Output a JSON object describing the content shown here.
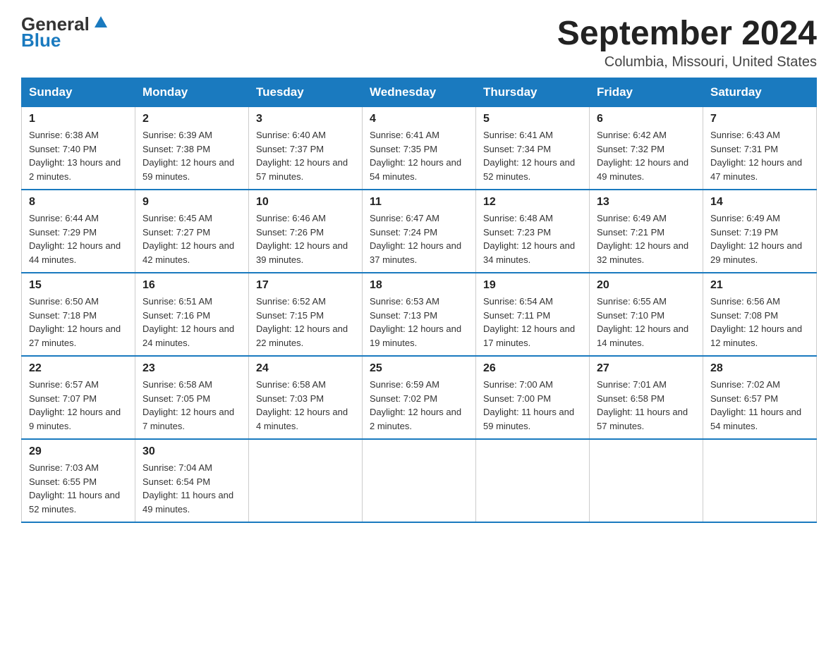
{
  "header": {
    "logo_general": "General",
    "logo_blue": "Blue",
    "title": "September 2024",
    "subtitle": "Columbia, Missouri, United States"
  },
  "days_of_week": [
    "Sunday",
    "Monday",
    "Tuesday",
    "Wednesday",
    "Thursday",
    "Friday",
    "Saturday"
  ],
  "weeks": [
    [
      {
        "day": "1",
        "sunrise": "6:38 AM",
        "sunset": "7:40 PM",
        "daylight": "13 hours and 2 minutes."
      },
      {
        "day": "2",
        "sunrise": "6:39 AM",
        "sunset": "7:38 PM",
        "daylight": "12 hours and 59 minutes."
      },
      {
        "day": "3",
        "sunrise": "6:40 AM",
        "sunset": "7:37 PM",
        "daylight": "12 hours and 57 minutes."
      },
      {
        "day": "4",
        "sunrise": "6:41 AM",
        "sunset": "7:35 PM",
        "daylight": "12 hours and 54 minutes."
      },
      {
        "day": "5",
        "sunrise": "6:41 AM",
        "sunset": "7:34 PM",
        "daylight": "12 hours and 52 minutes."
      },
      {
        "day": "6",
        "sunrise": "6:42 AM",
        "sunset": "7:32 PM",
        "daylight": "12 hours and 49 minutes."
      },
      {
        "day": "7",
        "sunrise": "6:43 AM",
        "sunset": "7:31 PM",
        "daylight": "12 hours and 47 minutes."
      }
    ],
    [
      {
        "day": "8",
        "sunrise": "6:44 AM",
        "sunset": "7:29 PM",
        "daylight": "12 hours and 44 minutes."
      },
      {
        "day": "9",
        "sunrise": "6:45 AM",
        "sunset": "7:27 PM",
        "daylight": "12 hours and 42 minutes."
      },
      {
        "day": "10",
        "sunrise": "6:46 AM",
        "sunset": "7:26 PM",
        "daylight": "12 hours and 39 minutes."
      },
      {
        "day": "11",
        "sunrise": "6:47 AM",
        "sunset": "7:24 PM",
        "daylight": "12 hours and 37 minutes."
      },
      {
        "day": "12",
        "sunrise": "6:48 AM",
        "sunset": "7:23 PM",
        "daylight": "12 hours and 34 minutes."
      },
      {
        "day": "13",
        "sunrise": "6:49 AM",
        "sunset": "7:21 PM",
        "daylight": "12 hours and 32 minutes."
      },
      {
        "day": "14",
        "sunrise": "6:49 AM",
        "sunset": "7:19 PM",
        "daylight": "12 hours and 29 minutes."
      }
    ],
    [
      {
        "day": "15",
        "sunrise": "6:50 AM",
        "sunset": "7:18 PM",
        "daylight": "12 hours and 27 minutes."
      },
      {
        "day": "16",
        "sunrise": "6:51 AM",
        "sunset": "7:16 PM",
        "daylight": "12 hours and 24 minutes."
      },
      {
        "day": "17",
        "sunrise": "6:52 AM",
        "sunset": "7:15 PM",
        "daylight": "12 hours and 22 minutes."
      },
      {
        "day": "18",
        "sunrise": "6:53 AM",
        "sunset": "7:13 PM",
        "daylight": "12 hours and 19 minutes."
      },
      {
        "day": "19",
        "sunrise": "6:54 AM",
        "sunset": "7:11 PM",
        "daylight": "12 hours and 17 minutes."
      },
      {
        "day": "20",
        "sunrise": "6:55 AM",
        "sunset": "7:10 PM",
        "daylight": "12 hours and 14 minutes."
      },
      {
        "day": "21",
        "sunrise": "6:56 AM",
        "sunset": "7:08 PM",
        "daylight": "12 hours and 12 minutes."
      }
    ],
    [
      {
        "day": "22",
        "sunrise": "6:57 AM",
        "sunset": "7:07 PM",
        "daylight": "12 hours and 9 minutes."
      },
      {
        "day": "23",
        "sunrise": "6:58 AM",
        "sunset": "7:05 PM",
        "daylight": "12 hours and 7 minutes."
      },
      {
        "day": "24",
        "sunrise": "6:58 AM",
        "sunset": "7:03 PM",
        "daylight": "12 hours and 4 minutes."
      },
      {
        "day": "25",
        "sunrise": "6:59 AM",
        "sunset": "7:02 PM",
        "daylight": "12 hours and 2 minutes."
      },
      {
        "day": "26",
        "sunrise": "7:00 AM",
        "sunset": "7:00 PM",
        "daylight": "11 hours and 59 minutes."
      },
      {
        "day": "27",
        "sunrise": "7:01 AM",
        "sunset": "6:58 PM",
        "daylight": "11 hours and 57 minutes."
      },
      {
        "day": "28",
        "sunrise": "7:02 AM",
        "sunset": "6:57 PM",
        "daylight": "11 hours and 54 minutes."
      }
    ],
    [
      {
        "day": "29",
        "sunrise": "7:03 AM",
        "sunset": "6:55 PM",
        "daylight": "11 hours and 52 minutes."
      },
      {
        "day": "30",
        "sunrise": "7:04 AM",
        "sunset": "6:54 PM",
        "daylight": "11 hours and 49 minutes."
      },
      null,
      null,
      null,
      null,
      null
    ]
  ]
}
